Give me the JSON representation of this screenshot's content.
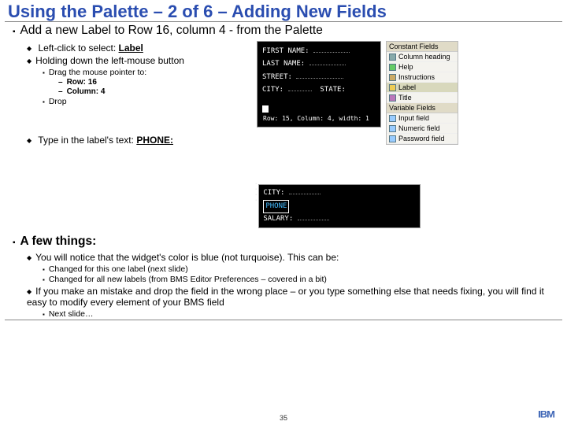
{
  "title": "Using the Palette – 2 of 6 – Adding New Fields",
  "h1": "Add a new Label to Row 16, column 4 - from the Palette",
  "bul": {
    "a": "Left-click to select: ",
    "a_b": "Label",
    "b": "Holding down the left-mouse button",
    "b1": "Drag the mouse pointer to:",
    "b1a_l": "Row:",
    "b1a_v": " 16",
    "b1b_l": "Column:",
    "b1b_v": " 4",
    "b2": "Drop",
    "c": "Type in the label's text:  ",
    "c_b": "PHONE:"
  },
  "few": {
    "h": "A few things:",
    "a": "You will notice that the widget's color is blue (not turquoise).  This can be:",
    "a1": "Changed for this one label (next slide)",
    "a2": "Changed for all new labels (from BMS Editor Preferences – covered in a bit)",
    "b": "If you make an mistake and drop the field in the wrong place – or you type something else that needs fixing, you will find it easy to modify every element of your BMS field",
    "b1": "Next slide…"
  },
  "page": "35",
  "form1": {
    "r1": "FIRST NAME:",
    "r2": "LAST NAME:",
    "r3": "STREET:",
    "r4a": "CITY:",
    "r4b": "STATE:",
    "tip": "Row: 15, Column: 4, width: 1"
  },
  "palette": {
    "sec1": "Constant Fields",
    "i1": "Column heading",
    "i2": "Help",
    "i3": "Instructions",
    "i4": "Label",
    "i5": "Title",
    "sec2": "Variable Fields",
    "i6": "Input field",
    "i7": "Numeric field",
    "i8": "Password field"
  },
  "form2": {
    "r1": "CITY:",
    "r2": "PHONE",
    "r3": "SALARY:"
  },
  "ibm": "IBM"
}
